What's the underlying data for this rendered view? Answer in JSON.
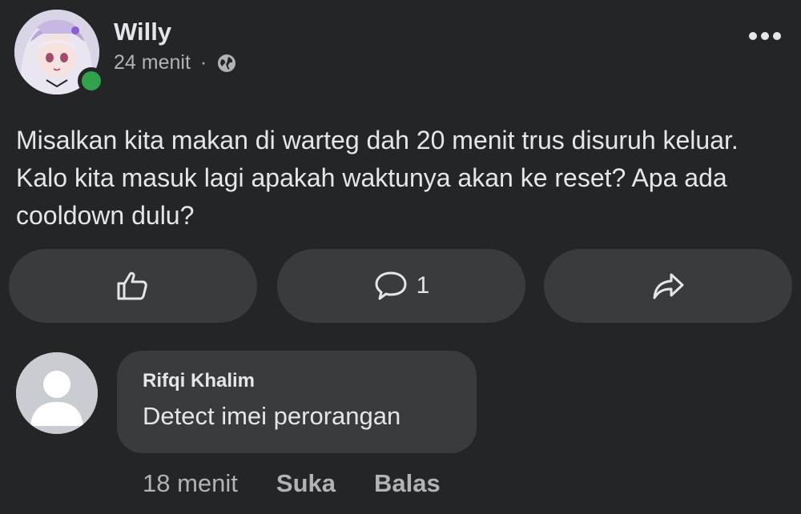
{
  "post": {
    "author": "Willy",
    "timestamp": "24 menit",
    "separator": "·",
    "audience_icon": "globe-icon",
    "more_icon": "more-options-icon",
    "text": "Misalkan kita makan di warteg dah 20 menit trus disuruh keluar. Kalo kita masuk lagi apakah waktunya akan ke reset? Apa ada cooldown dulu?",
    "comment_count": "1",
    "online_status_color": "#31a24c"
  },
  "actions": {
    "like_icon": "thumbs-up-icon",
    "comment_icon": "comment-bubble-icon",
    "share_icon": "share-arrow-icon"
  },
  "comment": {
    "author": "Rifqi Khalim",
    "text": "Detect imei perorangan",
    "timestamp": "18 menit",
    "like_label": "Suka",
    "reply_label": "Balas"
  },
  "theme": {
    "background": "#242526",
    "surface": "#3a3b3c",
    "text_primary": "#e4e6eb",
    "text_secondary": "#b0b3b8"
  }
}
